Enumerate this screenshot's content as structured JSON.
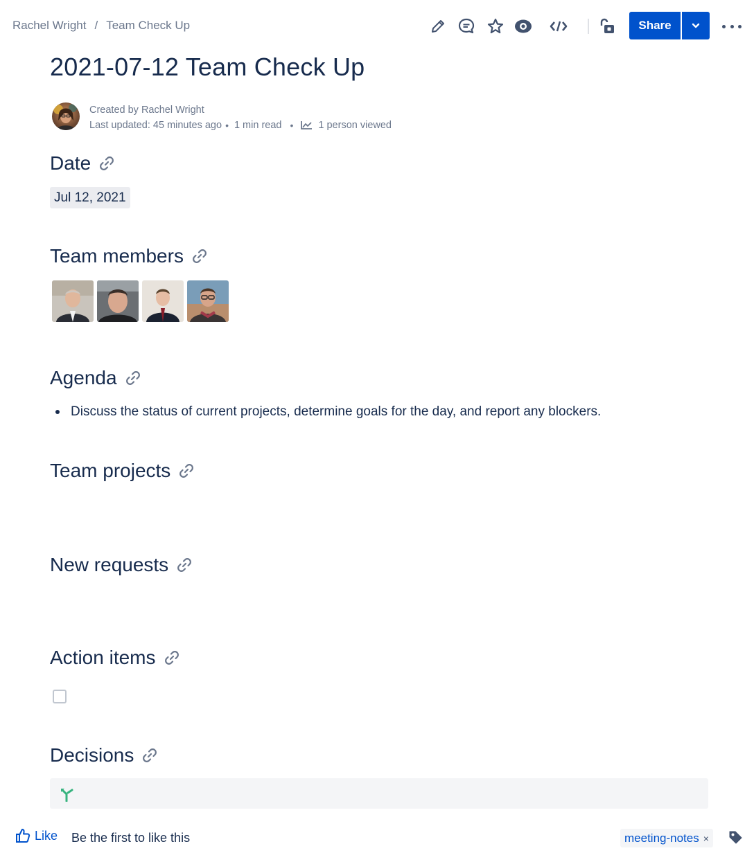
{
  "breadcrumb": {
    "items": [
      "Rachel Wright",
      "Team Check Up"
    ],
    "separator": "/"
  },
  "toolbar": {
    "icons": [
      "edit-icon",
      "comment-icon",
      "star-icon",
      "watch-icon",
      "source-icon",
      "restrictions-icon"
    ],
    "share_label": "Share",
    "accent": "#0052cc"
  },
  "page": {
    "title": "2021-07-12 Team Check Up",
    "byline": {
      "created_by": "Created by Rachel Wright",
      "last_updated": "Last updated: 45 minutes ago",
      "read_time": "1 min read",
      "views": "1 person viewed"
    }
  },
  "sections": {
    "date": {
      "heading": "Date",
      "value": "Jul 12, 2021"
    },
    "team_members": {
      "heading": "Team members",
      "count": 4
    },
    "agenda": {
      "heading": "Agenda",
      "items": [
        "Discuss the status of current projects, determine goals for the day, and report any blockers."
      ]
    },
    "team_projects": {
      "heading": "Team projects"
    },
    "new_requests": {
      "heading": "New requests"
    },
    "action_items": {
      "heading": "Action items"
    },
    "decisions": {
      "heading": "Decisions"
    }
  },
  "footer": {
    "like_label": "Like",
    "like_note": "Be the first to like this",
    "label": "meeting-notes",
    "label_remove": "×"
  }
}
